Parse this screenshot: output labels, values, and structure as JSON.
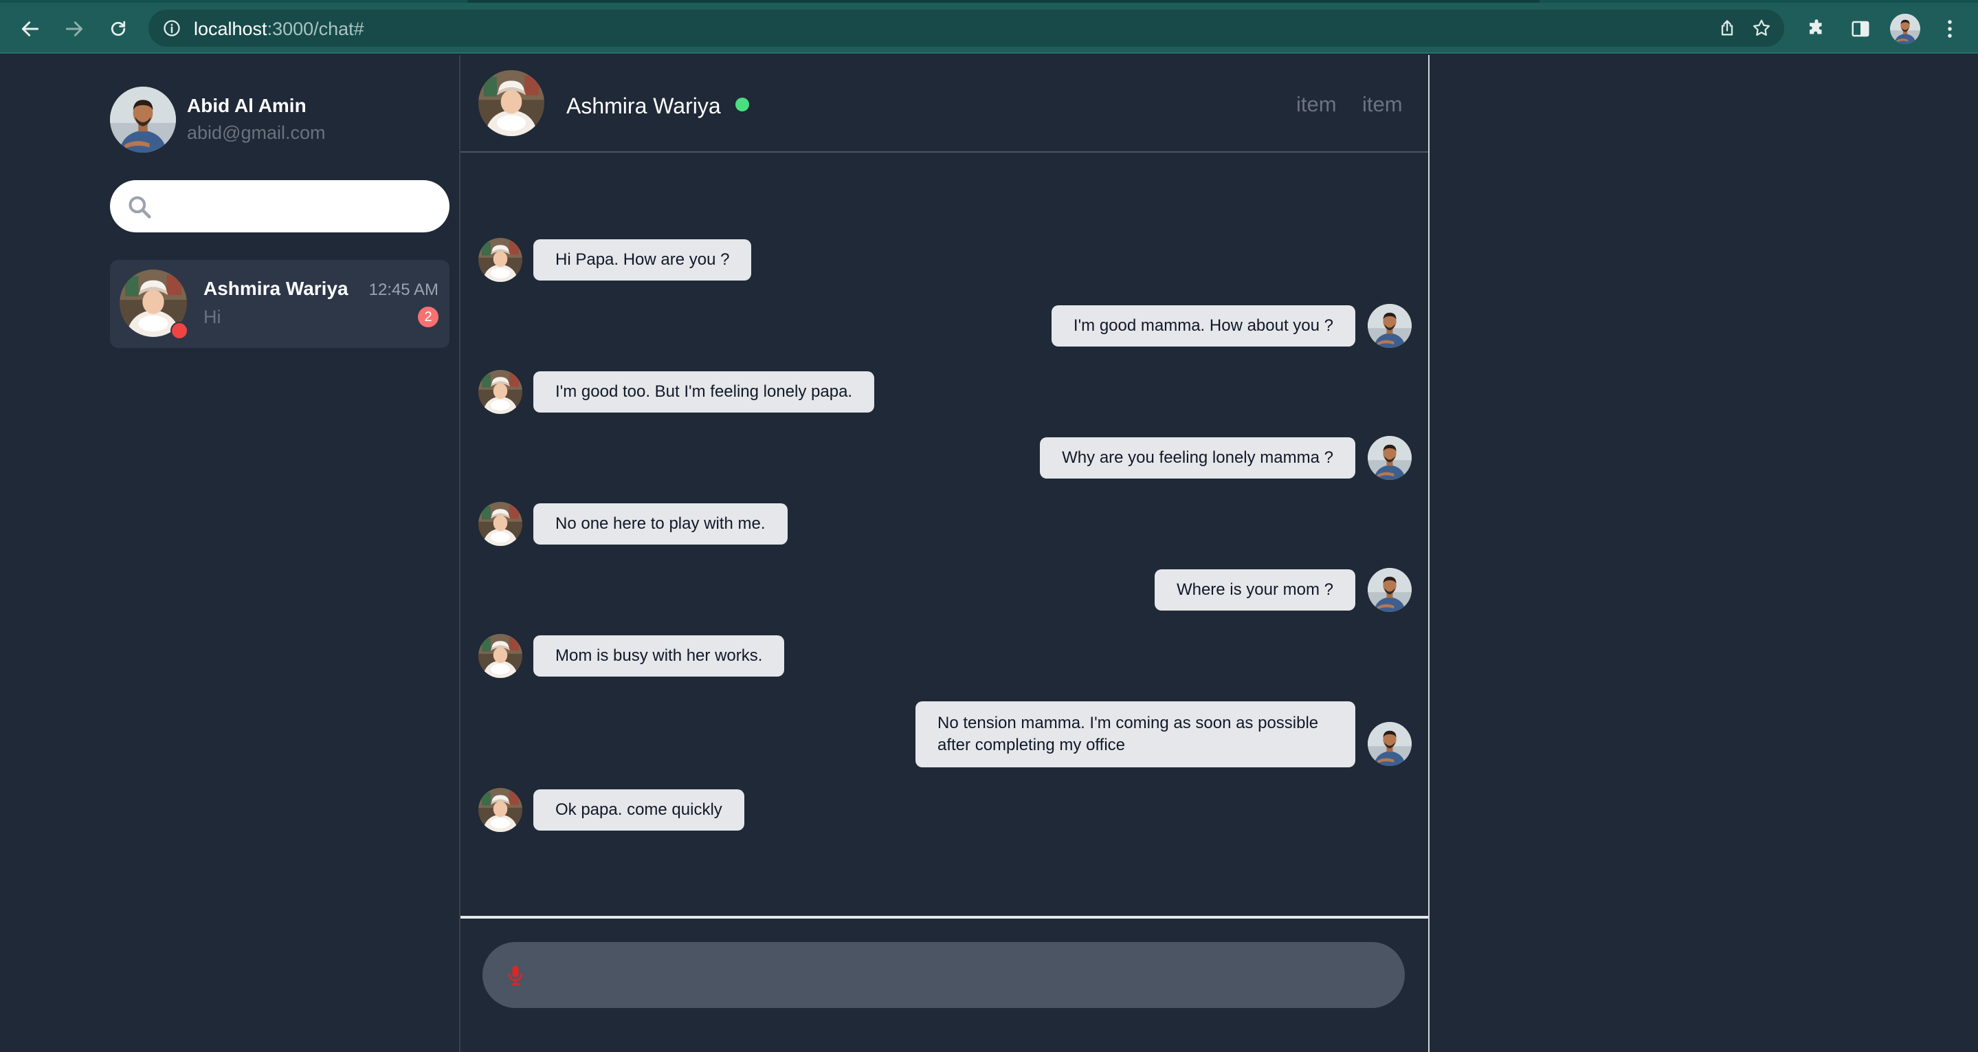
{
  "browser": {
    "url_host": "localhost",
    "url_path": ":3000/chat#",
    "icons": [
      "back-arrow-icon",
      "forward-arrow-icon",
      "reload-icon",
      "info-icon",
      "share-icon",
      "star-icon",
      "puzzle-icon",
      "sidebar-icon",
      "menu-dots-icon"
    ]
  },
  "me": {
    "name": "Abid Al Amin",
    "email": "abid@gmail.com"
  },
  "search": {
    "placeholder": ""
  },
  "contacts": [
    {
      "name": "Ashmira Wariya",
      "time": "12:45 AM",
      "preview": "Hi",
      "unread": "2",
      "status": "offline"
    }
  ],
  "chat": {
    "peer_name": "Ashmira Wariya",
    "peer_status": "online",
    "header_items": [
      "item",
      "item"
    ],
    "messages": [
      {
        "from": "peer",
        "text": "Hi Papa. How are you ?"
      },
      {
        "from": "me",
        "text": "I'm good mamma. How about you ?"
      },
      {
        "from": "peer",
        "text": "I'm good too. But I'm feeling lonely papa."
      },
      {
        "from": "me",
        "text": "Why are you feeling lonely mamma ?"
      },
      {
        "from": "peer",
        "text": "No one here to play with me."
      },
      {
        "from": "me",
        "text": "Where is your mom ?"
      },
      {
        "from": "peer",
        "text": "Mom is busy with her works."
      },
      {
        "from": "me",
        "text": "No tension mamma. I'm coming as soon as possible after completing my office"
      },
      {
        "from": "peer",
        "text": "Ok papa. come quickly"
      }
    ],
    "composer_placeholder": ""
  },
  "colors": {
    "background": "#1f2937",
    "bubble": "#e5e7eb",
    "online": "#4ade80",
    "offline": "#ef4444",
    "badge": "#f87171",
    "mic": "#dc2626",
    "browser_bar": "#1e5d5a"
  }
}
